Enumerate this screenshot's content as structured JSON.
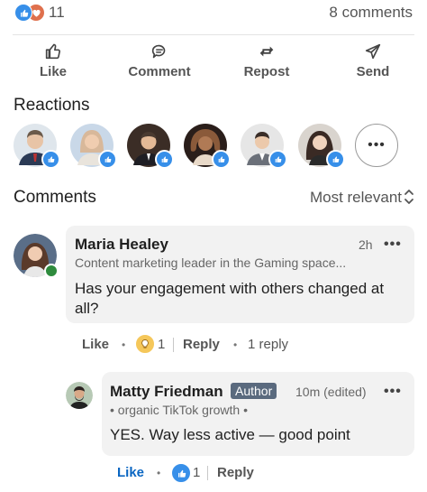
{
  "social": {
    "reaction_count": "11",
    "comments_count": "8 comments"
  },
  "actions": [
    {
      "label": "Like",
      "icon": "thumbs-up-icon"
    },
    {
      "label": "Comment",
      "icon": "comment-icon"
    },
    {
      "label": "Repost",
      "icon": "repost-icon"
    },
    {
      "label": "Send",
      "icon": "send-icon"
    }
  ],
  "reactions": {
    "title": "Reactions",
    "avatars": [
      {
        "color": "#6b5a4a"
      },
      {
        "color": "#d8b89a"
      },
      {
        "color": "#4a3a30"
      },
      {
        "color": "#8a5a3a"
      },
      {
        "color": "#cfcfcf"
      },
      {
        "color": "#3a2a24"
      }
    ],
    "more_label": "•••"
  },
  "comments": {
    "title": "Comments",
    "sort_label": "Most relevant",
    "items": [
      {
        "name": "Maria Healey",
        "headline": "Content marketing leader in the Gaming space...",
        "time": "2h",
        "text": "Has your engagement with others changed at all?",
        "like_label": "Like",
        "reaction_count": "1",
        "reply_label": "Reply",
        "replies_label": "1 reply"
      }
    ],
    "reply": {
      "name": "Matty Friedman",
      "badge": "Author",
      "time": "10m (edited)",
      "headline": "• organic TikTok growth •",
      "text": "YES. Way less active — good point",
      "like_label": "Like",
      "reaction_count": "1",
      "reply_label": "Reply"
    }
  },
  "colors": {
    "accent": "#0a66c2",
    "like_blue": "#378fe9",
    "love": "#df704d",
    "bubble": "#f2f2f2",
    "online": "#2e8b3d"
  }
}
